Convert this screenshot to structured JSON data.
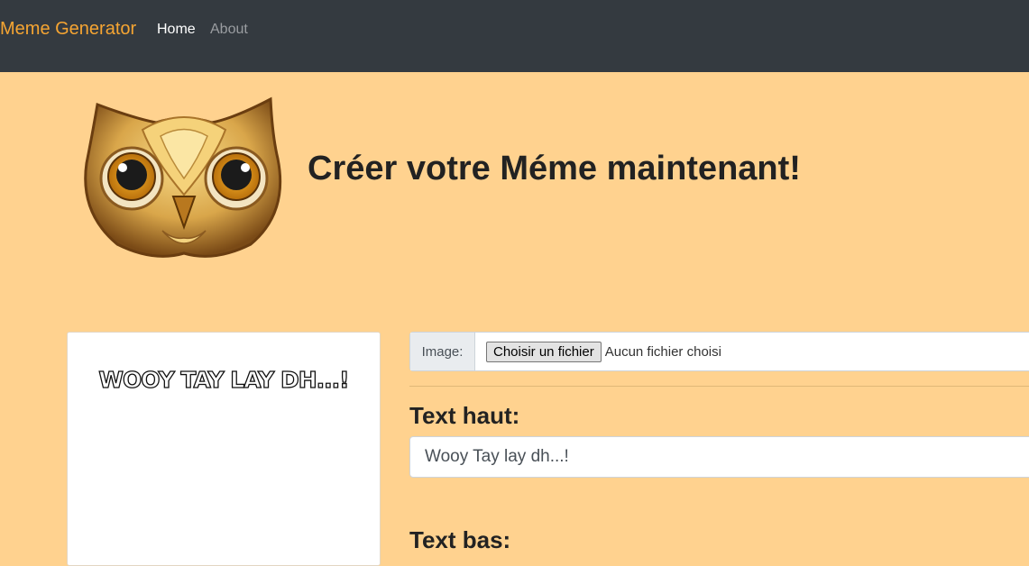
{
  "navbar": {
    "brand": "Meme Generator",
    "links": [
      {
        "label": "Home",
        "active": true
      },
      {
        "label": "About",
        "active": false
      }
    ]
  },
  "hero": {
    "title": "Créer votre Méme maintenant!",
    "logo_icon": "owl-icon"
  },
  "preview": {
    "top_text": "Wooy Tay lay dh...!"
  },
  "form": {
    "image_label": "Image:",
    "file_button": "Choisir un fichier",
    "file_status": "Aucun fichier choisi",
    "top_label": "Text haut:",
    "top_value": "Wooy Tay lay dh...!",
    "bottom_label": "Text bas:"
  },
  "colors": {
    "page_bg": "#ffd28f",
    "navbar_bg": "#343a40",
    "brand": "#f6a532"
  }
}
